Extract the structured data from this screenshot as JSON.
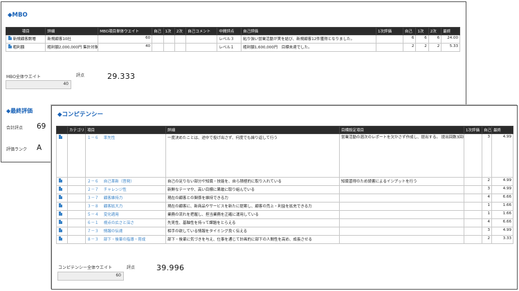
{
  "mbo": {
    "title": "◆MBO",
    "headers": [
      "項目",
      "詳細",
      "MBO項目単体ウエイト",
      "自己",
      "1次",
      "2次",
      "自己コメント",
      "中間評点",
      "自己評価",
      "1次評価",
      "自己",
      "1次",
      "2次",
      "最終"
    ],
    "rows": [
      {
        "item": "新規顧客数増",
        "detail": "新規顧客10社",
        "weight": "60",
        "self": "",
        "first": "",
        "second": "",
        "comment": "",
        "mid": "レベル３",
        "self_eval": "粘り強い営業活動が実を結び、新規顧客12件獲得となりました。",
        "first_eval": "",
        "s": "6",
        "f": "6",
        "n": "6",
        "final": "24.00"
      },
      {
        "item": "粗利額",
        "detail": "粗利額2,000,000円\n集計対象：〇〇、▲▲",
        "weight": "40",
        "self": "",
        "first": "",
        "second": "",
        "comment": "",
        "mid": "レベル１",
        "self_eval": "粗利額1,600,000円　目標未達でした。",
        "first_eval": "",
        "s": "2",
        "f": "2",
        "n": "2",
        "final": "5.33"
      }
    ],
    "weight_label": "MBO全体ウエイト",
    "weight_value": "40",
    "score_label": "評点",
    "score_value": "29.333"
  },
  "final_eval": {
    "title": "◆最終評価",
    "total_label": "合計評点",
    "total_value": "69",
    "rank_label": "評価ランク",
    "rank_value": "A"
  },
  "competency": {
    "title": "◆コンピテンシー",
    "headers": [
      "カテゴリ",
      "項目",
      "詳細",
      "目標設定項目",
      "1次評価",
      "自己",
      "最終"
    ],
    "rows": [
      {
        "code": "１－６",
        "name": "率先性",
        "detail": "一度決めたことは、途中で投げ出さず、何度でも繰り返して行う",
        "goal": "営業活動の週次のレポートを欠かさず作成し、提出する。\n\n提出回数3回以下···評点1\n提出回数4~7回···評点2\n提出回数8~11回···評点3\n提出回数12回以上···評点4",
        "first": "",
        "self": "3",
        "final": "4.99"
      },
      {
        "code": "２－６",
        "name": "自己革新（啓発）",
        "detail": "自己の足りない部分や知識・技能を、自ら積極的に取り入れている",
        "goal": "知識習得のため読書によるインプットを行う",
        "first": "",
        "self": "2",
        "final": "4.99"
      },
      {
        "code": "２－７",
        "name": "チャレンジ性",
        "detail": "新鮮なテーマや、高い目標に果敢に取り組んでいる",
        "goal": "",
        "first": "",
        "self": "3",
        "final": "4.99"
      },
      {
        "code": "３－７",
        "name": "顧客維持力",
        "detail": "現在の顧客との関係を維持できる力",
        "goal": "",
        "first": "",
        "self": "4",
        "final": "6.66"
      },
      {
        "code": "３－８",
        "name": "顧客拡大力",
        "detail": "現在の顧客に、新商品やサービスを新たに提案し、顧客の売上・利益を拡充できる力",
        "goal": "",
        "first": "",
        "self": "1",
        "final": "1.66"
      },
      {
        "code": "５－４",
        "name": "変化適用",
        "detail": "業務の流れを把握し、担当業務を正確に運用している",
        "goal": "",
        "first": "",
        "self": "1",
        "final": "1.66"
      },
      {
        "code": "６－１",
        "name": "視点の広さと深さ",
        "detail": "先見性、基軸性を持って課題をとらえる",
        "goal": "",
        "first": "",
        "self": "4",
        "final": "6.66"
      },
      {
        "code": "７－３",
        "name": "情報の伝達",
        "detail": "相手の欲している情報をタイミング良く伝える",
        "goal": "",
        "first": "",
        "self": "3",
        "final": "4.99"
      },
      {
        "code": "８－３",
        "name": "部下・後輩の指導・育成",
        "detail": "部下・後輩に気づきを与え、仕事を通じて計画的に部下の人間性を高め、成長させる",
        "goal": "",
        "first": "",
        "self": "2",
        "final": "3.33"
      }
    ],
    "weight_label": "コンピテンシー全体ウエイト",
    "weight_value": "60",
    "score_label": "評点",
    "score_value": "39.996"
  }
}
